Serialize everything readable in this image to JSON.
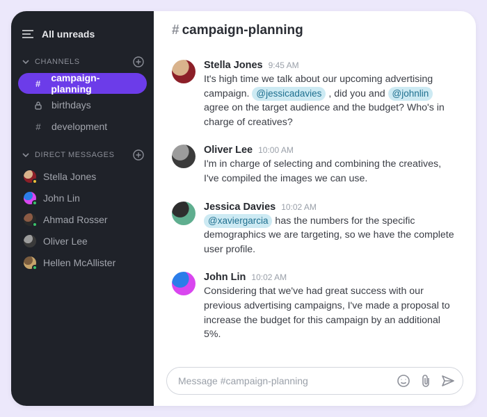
{
  "sidebar": {
    "all_unreads": "All unreads",
    "channels_label": "CHANNELS",
    "channels": [
      {
        "name": "campaign-planning",
        "kind": "hash",
        "active": true
      },
      {
        "name": "birthdays",
        "kind": "lock",
        "active": false
      },
      {
        "name": "development",
        "kind": "hash",
        "active": false
      }
    ],
    "dms_label": "DIRECT MESSAGES",
    "dms": [
      {
        "name": "Stella Jones",
        "avatar_colors": [
          "#d9b38c",
          "#8c1f28"
        ],
        "presence": "#eec23a"
      },
      {
        "name": "John Lin",
        "avatar_colors": [
          "#2b7de9",
          "#d946ef"
        ],
        "presence": "#3ac46b"
      },
      {
        "name": "Ahmad Rosser",
        "avatar_colors": [
          "#8a5a44",
          "#2a2a2a"
        ],
        "presence": "#3ac46b"
      },
      {
        "name": "Oliver Lee",
        "avatar_colors": [
          "#9c9c9c",
          "#3a3a3a"
        ],
        "presence": null
      },
      {
        "name": "Hellen McAllister",
        "avatar_colors": [
          "#7a5c3e",
          "#c7a46b"
        ],
        "presence": "#3ac46b"
      }
    ]
  },
  "header": {
    "channel_name": "campaign-planning"
  },
  "messages": [
    {
      "author": "Stella Jones",
      "time": "9:45 AM",
      "avatar_colors": [
        "#d9b38c",
        "#8c1f28"
      ],
      "segments": [
        {
          "t": "text",
          "v": "It's high time we talk about our upcoming advertising campaign. "
        },
        {
          "t": "mention",
          "v": "@jessicadavies"
        },
        {
          "t": "text",
          "v": " , did you and "
        },
        {
          "t": "mention",
          "v": "@johnlin"
        },
        {
          "t": "text",
          "v": " agree on the target audience and the budget? Who's in charge of creatives?"
        }
      ]
    },
    {
      "author": "Oliver Lee",
      "time": "10:00 AM",
      "avatar_colors": [
        "#9c9c9c",
        "#3a3a3a"
      ],
      "segments": [
        {
          "t": "text",
          "v": "I'm in charge of selecting and combining the creatives, I've compiled the images we can use."
        }
      ]
    },
    {
      "author": "Jessica Davies",
      "time": "10:02 AM",
      "avatar_colors": [
        "#2e2e2e",
        "#5fae8f"
      ],
      "segments": [
        {
          "t": "mention",
          "v": "@xaviergarcia"
        },
        {
          "t": "text",
          "v": " has the numbers for the specific demographics we are targeting, so we have the complete user profile."
        }
      ]
    },
    {
      "author": "John Lin",
      "time": "10:02 AM",
      "avatar_colors": [
        "#2b7de9",
        "#d946ef"
      ],
      "segments": [
        {
          "t": "text",
          "v": "Considering that we've had great success with our previous advertising campaigns, I've made a proposal to increase the budget for this campaign by an additional 5%."
        }
      ]
    }
  ],
  "composer": {
    "placeholder": "Message #campaign-planning"
  }
}
